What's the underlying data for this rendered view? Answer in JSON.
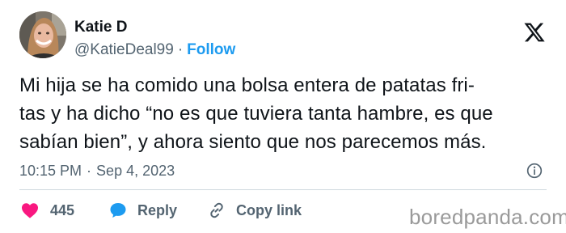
{
  "author": {
    "name": "Katie D",
    "handle": "@KatieDeal99",
    "separator": "·",
    "follow_label": "Follow"
  },
  "tweet": {
    "text": "Mi hija se ha comido una bolsa entera de patatas fri-\ntas y ha dicho “no es que tuviera tanta hambre, es que\nsabían bien”, y ahora siento que nos parecemos más.",
    "time": "10:15 PM",
    "date_separator": "·",
    "date": "Sep 4, 2023"
  },
  "actions": {
    "like_count": "445",
    "reply_label": "Reply",
    "copy_link_label": "Copy link"
  },
  "icons": {
    "logo": "x-logo-icon",
    "info": "info-icon",
    "like": "heart-icon",
    "reply": "speech-bubble-icon",
    "copy_link": "link-icon"
  },
  "colors": {
    "accent": "#1d9bf0",
    "like": "#f91880",
    "muted_text": "#536471",
    "primary_text": "#0f1419",
    "divider": "#cfd9de"
  },
  "watermark": "boredpanda.com"
}
